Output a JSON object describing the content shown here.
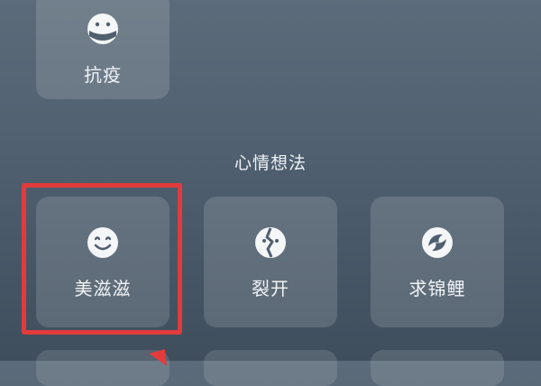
{
  "top_tile": {
    "label": "抗疫",
    "icon": "masked-face-icon"
  },
  "section": {
    "title": "心情想法"
  },
  "tiles": [
    {
      "label": "美滋滋",
      "icon": "smile-icon"
    },
    {
      "label": "裂开",
      "icon": "cracked-heart-icon"
    },
    {
      "label": "求锦鲤",
      "icon": "koi-fish-icon"
    }
  ],
  "colors": {
    "highlight": "#e23b3b",
    "tile_bg": "rgba(255,255,255,0.14)",
    "text": "#f1f3f5"
  }
}
